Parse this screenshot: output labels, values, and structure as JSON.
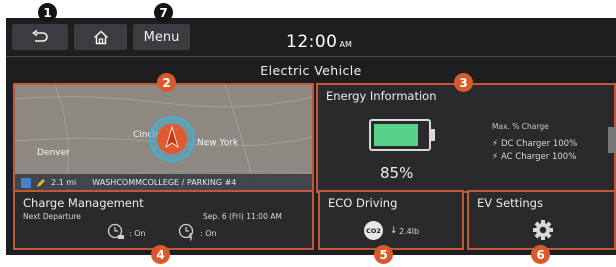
{
  "header": {
    "menu_label": "Menu",
    "clock_time": "12:00",
    "clock_ampm": "AM",
    "page_title": "Electric Vehicle"
  },
  "map_card": {
    "cities": [
      "Denver",
      "Cincinnati",
      "New York"
    ],
    "footer_distance": "2.1 mi",
    "footer_destination": "WASHCOMMCOLLEGE / PARKING #4"
  },
  "energy_card": {
    "title": "Energy Information",
    "battery_percent_text": "85%",
    "battery_level": 0.85,
    "max_charge_label": "Max. % Charge",
    "dc_charger": "DC Charger 100%",
    "ac_charger": "AC Charger 100%"
  },
  "charge_card": {
    "title": "Charge Management",
    "next_departure_label": "Next Departure",
    "departure_time": "Sep. 6 (Fri) 11:00 AM",
    "climate_status": ": On",
    "charge_status": ": On"
  },
  "eco_card": {
    "title": "ECO Driving",
    "co2_label": "CO2",
    "co2_value": "2.4lb"
  },
  "ev_settings_card": {
    "title": "EV Settings"
  },
  "callouts": [
    "1",
    "2",
    "3",
    "4",
    "5",
    "6",
    "7"
  ],
  "colors": {
    "accent_border": "#c0583a",
    "badge_orange": "#d85a2a",
    "battery_green": "#58d08a",
    "screen_bg": "#1e1e20"
  },
  "icons": [
    "back-icon",
    "home-icon",
    "gear-icon",
    "lightning-icon",
    "leaf-icon",
    "clock-climate-icon",
    "clock-charge-icon",
    "co2-icon",
    "down-arrow-icon",
    "compass-icon"
  ]
}
